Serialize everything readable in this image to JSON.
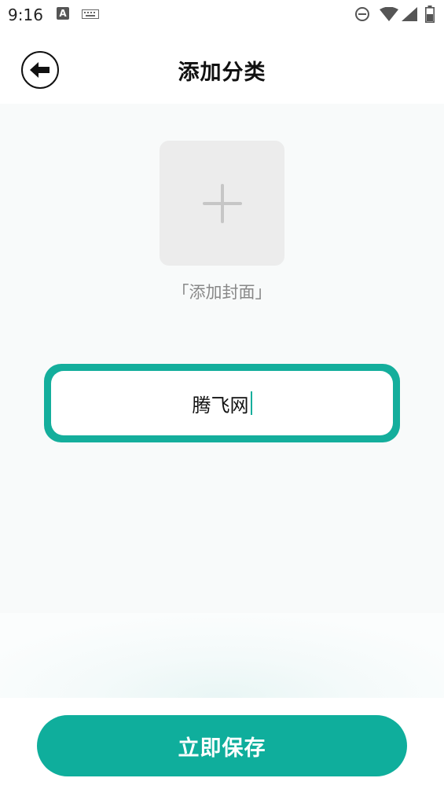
{
  "status_bar": {
    "time": "9:16",
    "a_badge": "A",
    "icons": [
      "a-icon",
      "keyboard-icon",
      "do-not-disturb-icon",
      "wifi-icon",
      "signal-icon",
      "battery-icon"
    ]
  },
  "header": {
    "title": "添加分类",
    "back_icon": "arrow-left-icon"
  },
  "cover": {
    "label": "「添加封面」",
    "icon": "plus-icon"
  },
  "name_input": {
    "value": "腾飞网"
  },
  "save_button": {
    "label": "立即保存"
  },
  "colors": {
    "accent": "#0fae9c",
    "background": "#f8fafa",
    "placeholder_box": "#ececec",
    "muted_text": "#888888"
  }
}
